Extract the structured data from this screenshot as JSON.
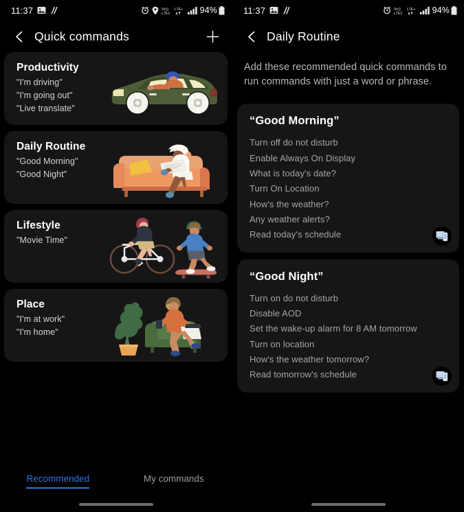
{
  "left": {
    "statusbar": {
      "time": "11:37",
      "left_icons": [
        "photo-icon",
        "no-sound-icon"
      ],
      "right_icons": [
        "alarm-icon",
        "location-icon",
        "volte-icon",
        "lte-plus-icon",
        "signal-icon"
      ],
      "battery": "94%"
    },
    "appbar": {
      "back": "back-arrow",
      "title": "Quick commands",
      "add": "plus"
    },
    "cards": [
      {
        "title": "Productivity",
        "phrases": [
          "\"I'm driving\"",
          "\"I'm going out\"",
          "\"Live translate\""
        ],
        "art": "car"
      },
      {
        "title": "Daily Routine",
        "phrases": [
          "\"Good Morning\"",
          "\"Good Night\""
        ],
        "art": "couch"
      },
      {
        "title": "Lifestyle",
        "phrases": [
          "\"Movie Time\""
        ],
        "art": "bike"
      },
      {
        "title": "Place",
        "phrases": [
          "\"I'm at work\"",
          "\"I'm home\""
        ],
        "art": "armchair"
      }
    ],
    "tabs": [
      {
        "label": "Recommended",
        "active": true
      },
      {
        "label": "My commands",
        "active": false
      }
    ]
  },
  "right": {
    "statusbar": {
      "time": "11:37",
      "left_icons": [
        "photo-icon",
        "no-sound-icon"
      ],
      "right_icons": [
        "alarm-icon",
        "volte-icon",
        "lte-plus-icon",
        "signal-icon"
      ],
      "battery": "94%"
    },
    "appbar": {
      "back": "back-arrow",
      "title": "Daily Routine"
    },
    "intro": "Add these recommended quick commands to run commands with just a word or phrase.",
    "groups": [
      {
        "title": "“Good Morning”",
        "commands": [
          "Turn off do not disturb",
          "Enable Always On Display",
          "What is today's date?",
          "Turn On Location",
          "How's the weather?",
          "Any weather alerts?",
          "Read today's schedule"
        ],
        "button": "devices-icon"
      },
      {
        "title": "“Good Night”",
        "commands": [
          "Turn on do not disturb",
          "Disable AOD",
          "Set the wake-up alarm for 8 AM tomorrow",
          "Turn on location",
          "How's the weather tomorrow?",
          "Read tomorrow's schedule"
        ],
        "button": "devices-icon"
      }
    ]
  },
  "colors": {
    "background": "#000000",
    "card": "#161616",
    "accent": "#2f73e8",
    "title_text": "#ffffff",
    "body_text": "#a5a5a5"
  }
}
